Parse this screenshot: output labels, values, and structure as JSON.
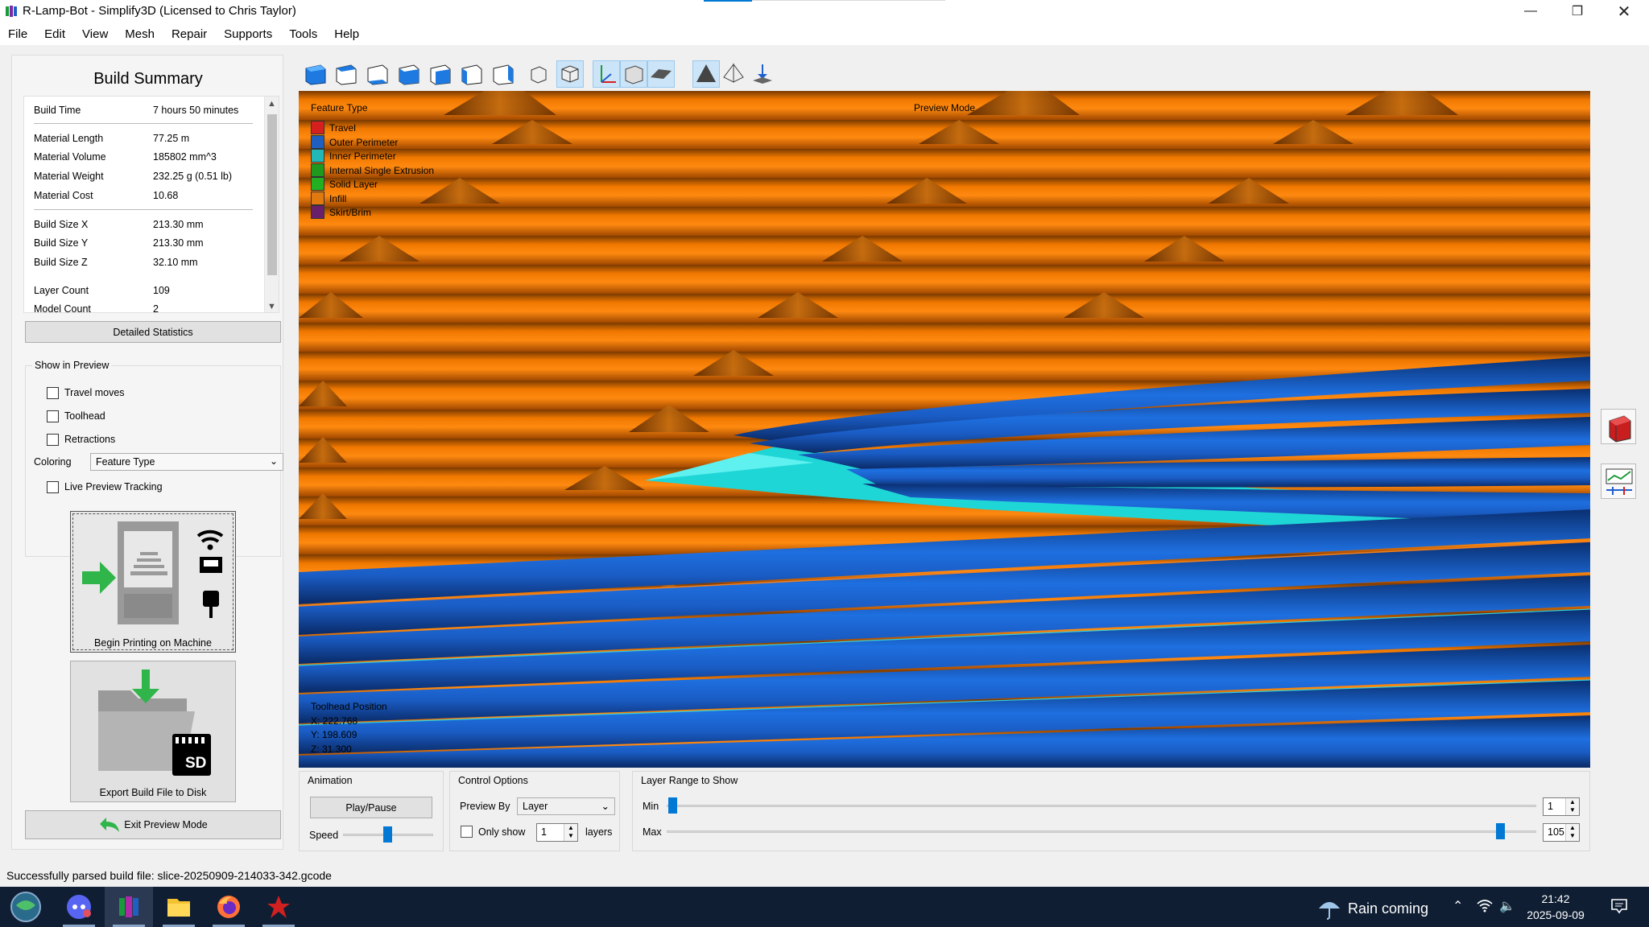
{
  "window": {
    "title": "R-Lamp-Bot - Simplify3D (Licensed to Chris Taylor)",
    "minimize_icon": "minimize-icon",
    "maximize_icon": "restore-icon",
    "close_icon": "close-icon"
  },
  "menu": [
    "File",
    "Edit",
    "View",
    "Mesh",
    "Repair",
    "Supports",
    "Tools",
    "Help"
  ],
  "build_summary": {
    "title": "Build Summary",
    "rows": [
      {
        "key": "Build Time",
        "value": "7 hours 50 minutes"
      },
      {
        "key": "Material Length",
        "value": "77.25 m"
      },
      {
        "key": "Material Volume",
        "value": "185802 mm^3"
      },
      {
        "key": "Material Weight",
        "value": "232.25 g (0.51 lb)"
      },
      {
        "key": "Material Cost",
        "value": "10.68"
      },
      {
        "key": "Build Size X",
        "value": "213.30 mm"
      },
      {
        "key": "Build Size Y",
        "value": "213.30 mm"
      },
      {
        "key": "Build Size Z",
        "value": "32.10 mm"
      },
      {
        "key": "Layer Count",
        "value": "109"
      },
      {
        "key": "Model Count",
        "value": "2"
      }
    ],
    "detailed_button": "Detailed Statistics"
  },
  "show_in_preview": {
    "title": "Show in Preview",
    "travel_moves": "Travel moves",
    "toolhead": "Toolhead",
    "retractions": "Retractions",
    "coloring_label": "Coloring",
    "coloring_value": "Feature Type",
    "live_tracking": "Live Preview Tracking"
  },
  "actions": {
    "begin_printing": "Begin Printing on Machine",
    "export": "Export Build File to Disk",
    "sd_label": "SD",
    "exit_preview": "Exit Preview Mode"
  },
  "toolbar_icons": [
    "view-iso-icon",
    "view-top-icon",
    "view-bottom-icon",
    "view-front-icon",
    "view-back-icon",
    "view-left-icon",
    "view-right-icon",
    "wireframe-icon",
    "solid-model-icon",
    "axes-icon",
    "build-volume-icon",
    "shadow-icon",
    "cross-section-icon",
    "mirror-icon",
    "place-on-bed-icon"
  ],
  "viewport": {
    "legend_title": "Feature Type",
    "mode_label": "Preview Mode",
    "legend": [
      {
        "name": "Travel",
        "color": "#d61f1f"
      },
      {
        "name": "Outer Perimeter",
        "color": "#1f5fbf"
      },
      {
        "name": "Inner Perimeter",
        "color": "#22b8b8"
      },
      {
        "name": "Internal Single Extrusion",
        "color": "#1f9a1f"
      },
      {
        "name": "Solid Layer",
        "color": "#22b022"
      },
      {
        "name": "Infill",
        "color": "#e07a10"
      },
      {
        "name": "Skirt/Brim",
        "color": "#6a1f6a"
      }
    ],
    "toolhead_title": "Toolhead Position",
    "toolhead_x": "X: 222.768",
    "toolhead_y": "Y: 198.609",
    "toolhead_z": "Z: 31.300"
  },
  "animation": {
    "title": "Animation",
    "play_pause": "Play/Pause",
    "speed_label": "Speed"
  },
  "control_options": {
    "title": "Control Options",
    "preview_by_label": "Preview By",
    "preview_by_value": "Layer",
    "only_show": "Only show",
    "only_show_value": "1",
    "layers_label": "layers"
  },
  "layer_range": {
    "title": "Layer Range to Show",
    "min_label": "Min",
    "max_label": "Max",
    "min_value": "1",
    "max_value": "105",
    "min_fraction": 0.0,
    "max_fraction": 0.96
  },
  "status": "Successfully parsed build file: slice-20250909-214033-342.gcode",
  "taskbar": {
    "apps": [
      "start-orb-icon",
      "discord-icon",
      "simplify3d-icon",
      "file-explorer-icon",
      "firefox-icon",
      "red-app-icon"
    ],
    "weather": "Rain coming",
    "time": "21:42",
    "date": "2025-09-09"
  }
}
